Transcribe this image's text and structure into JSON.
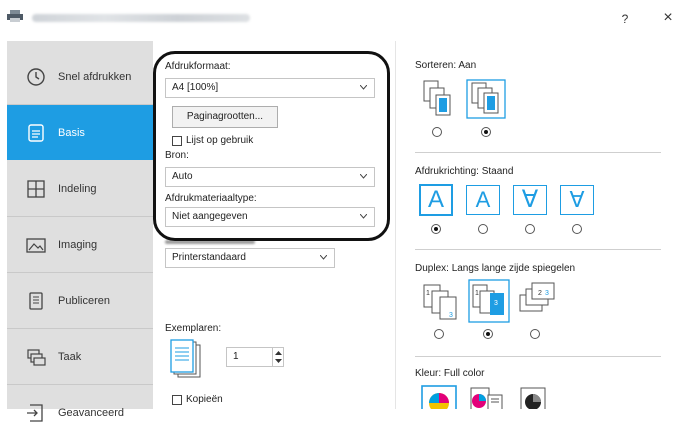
{
  "window": {
    "help": "?",
    "close": "×"
  },
  "sidebar": {
    "items": [
      {
        "label": "Snel afdrukken",
        "icon": "clock-icon"
      },
      {
        "label": "Basis",
        "icon": "document-icon",
        "active": true
      },
      {
        "label": "Indeling",
        "icon": "grid-layout-icon"
      },
      {
        "label": "Imaging",
        "icon": "image-icon"
      },
      {
        "label": "Publiceren",
        "icon": "booklet-icon"
      },
      {
        "label": "Taak",
        "icon": "stack-icon"
      },
      {
        "label": "Geavanceerd",
        "icon": "advanced-arrow-icon"
      }
    ]
  },
  "basic": {
    "print_size_label": "Afdrukformaat:",
    "print_size_value": "A4 [100%]",
    "page_sizes_button": "Paginagrootten...",
    "list_in_use_label": "Lijst op gebruik",
    "source_label": "Bron:",
    "source_value": "Auto",
    "media_type_label": "Afdrukmateriaaltype:",
    "media_type_value": "Niet aangegeven",
    "destination_value": "Printerstandaard",
    "copies_label": "Exemplaren:",
    "copies_value": "1",
    "copies_checkbox_label": "Kopieën"
  },
  "right": {
    "collate_label": "Sorteren:",
    "collate_value": "Aan",
    "orientation_label": "Afdrukrichting:",
    "orientation_value": "Staand",
    "orientation_glyph": "A",
    "orientation_glyph_rot": "∀",
    "duplex_label": "Duplex:",
    "duplex_value": "Langs lange zijde spiegelen",
    "color_label": "Kleur:",
    "color_value": "Full color"
  },
  "colors": {
    "accent": "#1e9de3",
    "sidebar_bg": "#dfdfdf"
  }
}
